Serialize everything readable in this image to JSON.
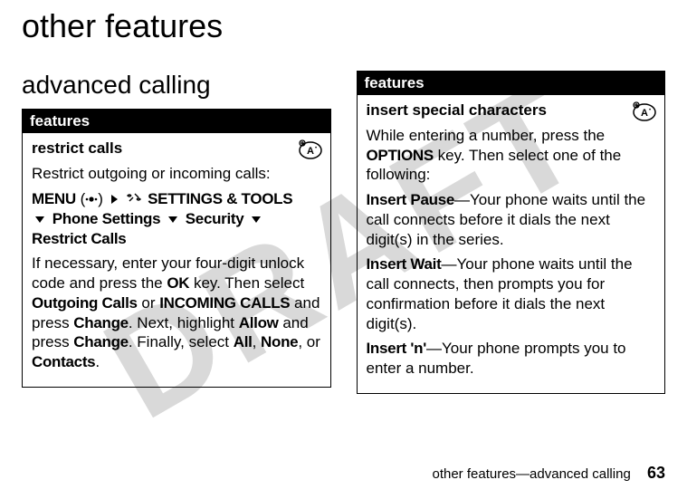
{
  "watermark": "DRAFT",
  "page_title": "other features",
  "section_title": "advanced calling",
  "box1": {
    "header": "features",
    "sub_title": "restrict calls",
    "line1": "Restrict outgoing or incoming calls:",
    "menu_label": "MENU",
    "menu_key": "(",
    "menu_key_end": ")",
    "settings_tools": "SETTINGS & TOOLS",
    "phone_settings": "Phone Settings",
    "security": "Security",
    "restrict_calls": "Restrict Calls",
    "p2a": "If necessary, enter your four-digit unlock code and press the ",
    "ok": "OK",
    "p2b": " key. Then select ",
    "outgoing": "Outgoing Calls",
    "p2c": " or ",
    "incoming": "INCOMING CALLS",
    "p2d": " and press ",
    "change1": "Change",
    "p2e": ". Next, highlight ",
    "allow": "Allow",
    "p2f": " and press ",
    "change2": "Change",
    "p2g": ". Finally, select ",
    "all": "All",
    "comma1": ", ",
    "none": "None",
    "comma2": ", or ",
    "contacts": "Contacts",
    "period": "."
  },
  "box2": {
    "header": "features",
    "sub_title": "insert special characters",
    "p1a": "While entering a number, press the ",
    "options": "OPTIONS",
    "p1b": " key. Then select one of the following:",
    "ip": "Insert Pause",
    "ip_text": "—Your phone waits until the call connects before it dials the next digit(s) in the series.",
    "iw": "Insert Wait",
    "iw_text": "—Your phone waits until the call connects, then prompts you for confirmation before it dials the next digit(s).",
    "in": "Insert 'n'",
    "in_text": "—Your phone prompts you to enter a number."
  },
  "footer": {
    "text": "other features—advanced calling",
    "page": "63"
  }
}
